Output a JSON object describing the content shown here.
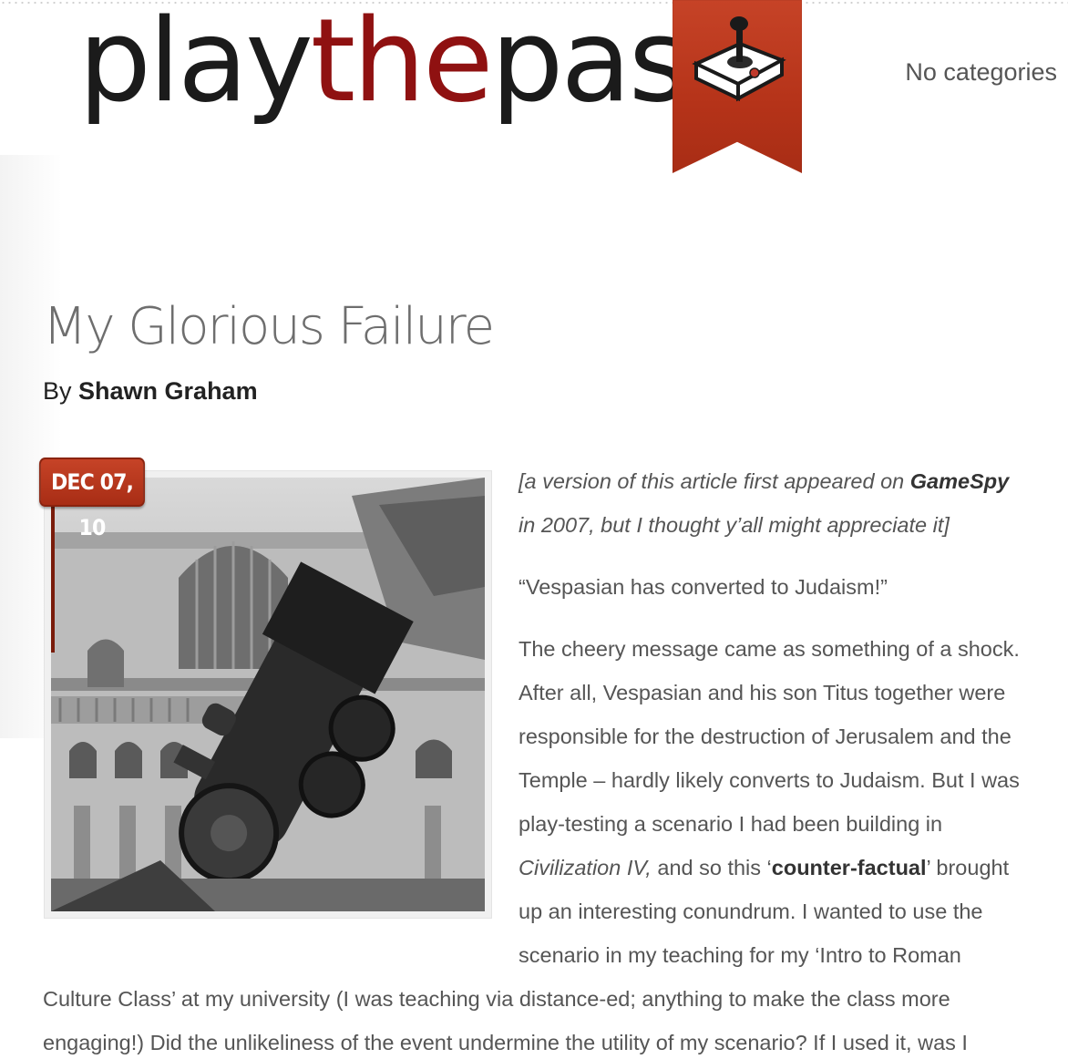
{
  "header": {
    "logo_part1": "play",
    "logo_part2": "the",
    "logo_part3": "past",
    "categories": "No categories",
    "brand_red": "#b53319",
    "logo_accent": "#8f1111",
    "emblem_icon": "joystick-icon"
  },
  "post": {
    "title": "My Glorious Failure",
    "by_label": "By",
    "author": "Shawn Graham",
    "date": "DEC 07, 10",
    "image_icon": "train-wreck-photo",
    "intro": {
      "l1_a": "[a version of this article first appeared on ",
      "l1_b": "GameSpy",
      "l2": "in 2007, but I thought y’all might appreciate it]"
    },
    "quote": "“Vespasian has converted to Judaism!”",
    "body": {
      "line1": "The cheery message came as something of a shock.",
      "line2": "After all, Vespasian and his son Titus together were",
      "line3": "responsible for the destruction of Jerusalem and the",
      "line4": "Temple – hardly likely converts to Judaism. But I was",
      "line5": "play-testing a scenario I had been building in",
      "line6_a": "Civilization IV,",
      "line6_b": " and so this ‘",
      "line6_c": "counter-factual",
      "line6_d": "’ brought",
      "line7": "up an interesting conundrum. I wanted to use the",
      "line8": "scenario in my teaching for my ‘Intro to Roman",
      "line9": "Culture Class’ at my university (I was teaching via distance-ed; anything to make the class more",
      "line10": "engaging!) Did the unlikeliness of the event undermine the utility of my scenario? If I used it, was I"
    }
  }
}
